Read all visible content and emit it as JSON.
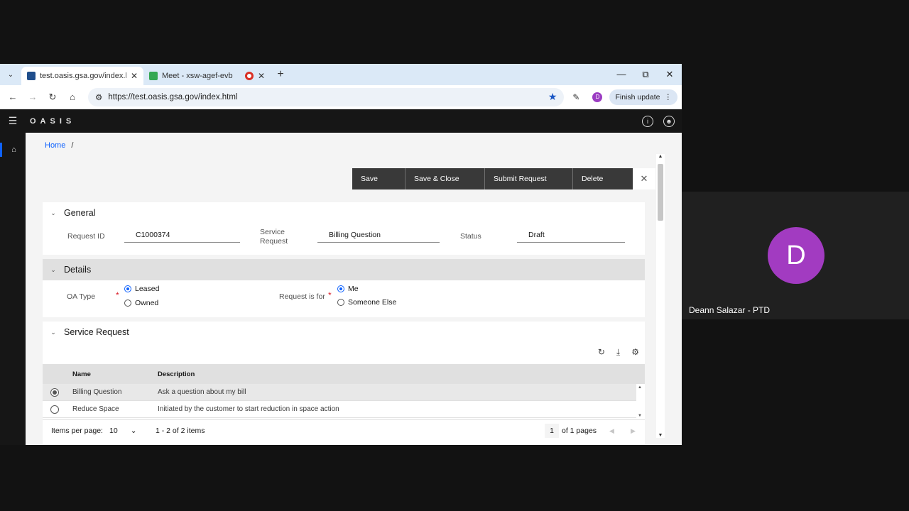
{
  "browser": {
    "tabs": [
      {
        "title": "test.oasis.gsa.gov/index.html",
        "active": true
      },
      {
        "title": "Meet - xsw-agef-evb",
        "active": false
      },
      {
        "title": "",
        "active": false
      }
    ],
    "url": "https://test.oasis.gsa.gov/index.html",
    "profile_initial": "D",
    "finish_update_label": "Finish update"
  },
  "app": {
    "logo": "OASIS",
    "breadcrumb": {
      "home": "Home",
      "sep": "/"
    },
    "actions": {
      "save": "Save",
      "save_close": "Save & Close",
      "submit": "Submit Request",
      "delete": "Delete"
    },
    "general": {
      "title": "General",
      "request_id_label": "Request ID",
      "request_id_value": "C1000374",
      "service_request_label_1": "Service",
      "service_request_label_2": "Request",
      "service_request_value": "Billing Question",
      "status_label": "Status",
      "status_value": "Draft"
    },
    "details": {
      "title": "Details",
      "oa_type_label": "OA Type",
      "oa_options": [
        "Leased",
        "Owned"
      ],
      "oa_selected": "Leased",
      "request_for_label": "Request is for",
      "request_for_options": [
        "Me",
        "Someone Else"
      ],
      "request_for_selected": "Me"
    },
    "service_request": {
      "title": "Service Request",
      "columns": [
        "Name",
        "Description"
      ],
      "rows": [
        {
          "name": "Billing Question",
          "description": "Ask a question about my bill",
          "selected": true
        },
        {
          "name": "Reduce Space",
          "description": "Initiated by the customer to start reduction in space action",
          "selected": false
        }
      ],
      "pager": {
        "items_per_page_label": "Items per page:",
        "items_per_page": "10",
        "range": "1 - 2 of 2 items",
        "page": "1",
        "of_pages": "of 1 pages"
      }
    }
  },
  "meet": {
    "participant_initial": "D",
    "participant_name": "Deann Salazar - PTD",
    "avatar_color": "#a23bc1"
  }
}
